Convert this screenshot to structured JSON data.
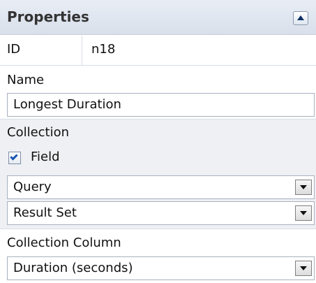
{
  "panel": {
    "title": "Properties",
    "collapse_icon": "chevron-up-icon"
  },
  "id_row": {
    "label": "ID",
    "value": "n18"
  },
  "name_section": {
    "label": "Name",
    "value": "Longest Duration"
  },
  "collection_section": {
    "label": "Collection",
    "field_checkbox": {
      "label": "Field",
      "checked": true
    },
    "query_dropdown": {
      "value": "Query"
    },
    "result_set_dropdown": {
      "value": "Result Set"
    }
  },
  "collection_column_section": {
    "label": "Collection Column",
    "dropdown": {
      "value": "Duration (seconds)"
    }
  }
}
